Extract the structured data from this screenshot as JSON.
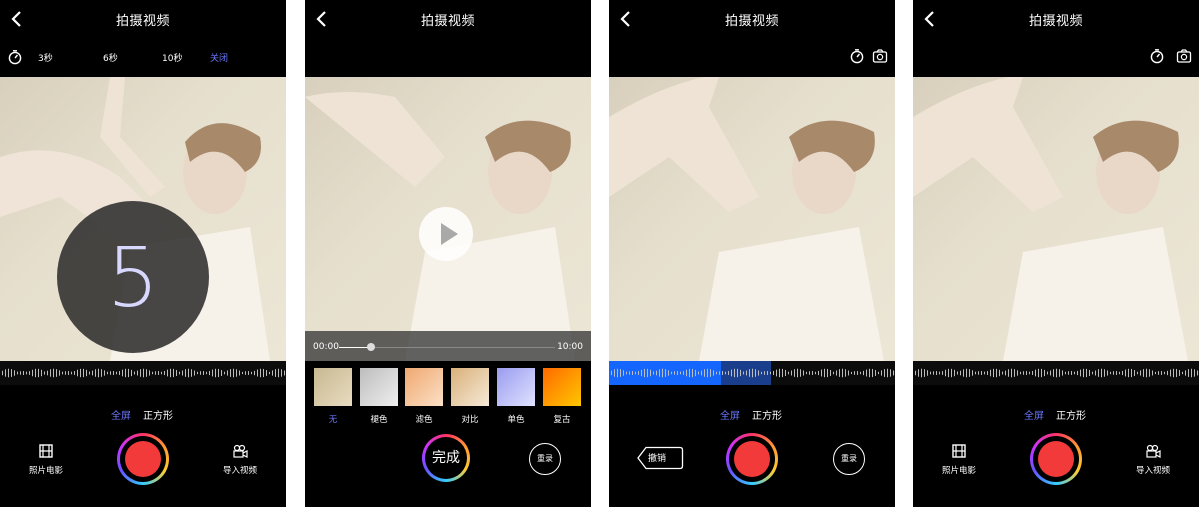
{
  "screens": [
    {
      "title": "拍摄视频",
      "timer_options": [
        "3秒",
        "6秒",
        "10秒",
        "关闭"
      ],
      "countdown": "5",
      "mode_full": "全屏",
      "mode_square": "正方形",
      "left_button": "照片电影",
      "right_button": "导入视频"
    },
    {
      "title": "拍摄视频",
      "time_start": "00:00",
      "time_end": "10:00",
      "filters": [
        "无",
        "褪色",
        "滤色",
        "对比",
        "单色",
        "复古"
      ],
      "done_label": "完成",
      "retake_label": "重录"
    },
    {
      "title": "拍摄视频",
      "mode_full": "全屏",
      "mode_square": "正方形",
      "undo_label": "撤销",
      "retake_label": "重录"
    },
    {
      "title": "拍摄视频",
      "mode_full": "全屏",
      "mode_square": "正方形",
      "left_button": "照片电影",
      "right_button": "导入视频"
    }
  ],
  "colors": {
    "accent": "#6b78ff",
    "record": "#f23a3a",
    "wave_highlight": "#1565ff"
  },
  "icons": [
    "back-icon",
    "timer-icon",
    "camera-switch-icon",
    "film-icon",
    "video-camera-icon",
    "play-icon"
  ]
}
